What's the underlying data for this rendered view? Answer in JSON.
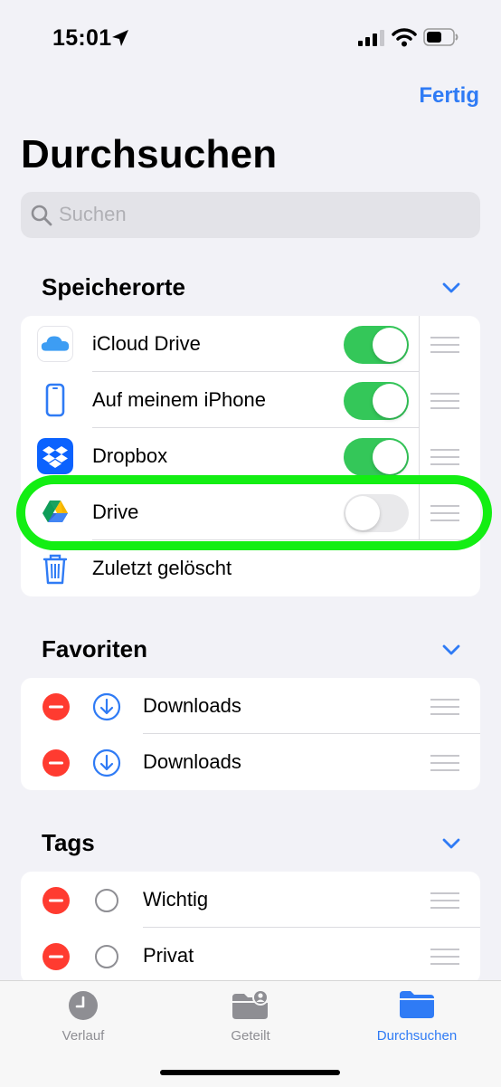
{
  "status": {
    "time": "15:01"
  },
  "nav": {
    "done_label": "Fertig",
    "title": "Durchsuchen"
  },
  "search": {
    "placeholder": "Suchen"
  },
  "locations": {
    "header": "Speicherorte",
    "items": [
      {
        "label": "iCloud Drive",
        "icon": "icloud-icon",
        "enabled": true
      },
      {
        "label": "Auf meinem iPhone",
        "icon": "iphone-icon",
        "enabled": true
      },
      {
        "label": "Dropbox",
        "icon": "dropbox-icon",
        "enabled": true
      },
      {
        "label": "Drive",
        "icon": "google-drive-icon",
        "enabled": false
      },
      {
        "label": "Zuletzt gelöscht",
        "icon": "trash-icon"
      }
    ]
  },
  "favorites": {
    "header": "Favoriten",
    "items": [
      {
        "label": "Downloads",
        "icon": "download-icon"
      },
      {
        "label": "Downloads",
        "icon": "download-icon"
      }
    ]
  },
  "tags": {
    "header": "Tags",
    "items": [
      {
        "label": "Wichtig"
      },
      {
        "label": "Privat"
      }
    ]
  },
  "tabbar": {
    "tabs": [
      {
        "label": "Verlauf",
        "icon": "clock-icon"
      },
      {
        "label": "Geteilt",
        "icon": "shared-folder-icon"
      },
      {
        "label": "Durchsuchen",
        "icon": "folder-icon",
        "active": true
      }
    ]
  },
  "colors": {
    "accent": "#2f7bf5",
    "toggle_on": "#34c759",
    "delete": "#ff3b30",
    "highlight": "#13ee13"
  }
}
